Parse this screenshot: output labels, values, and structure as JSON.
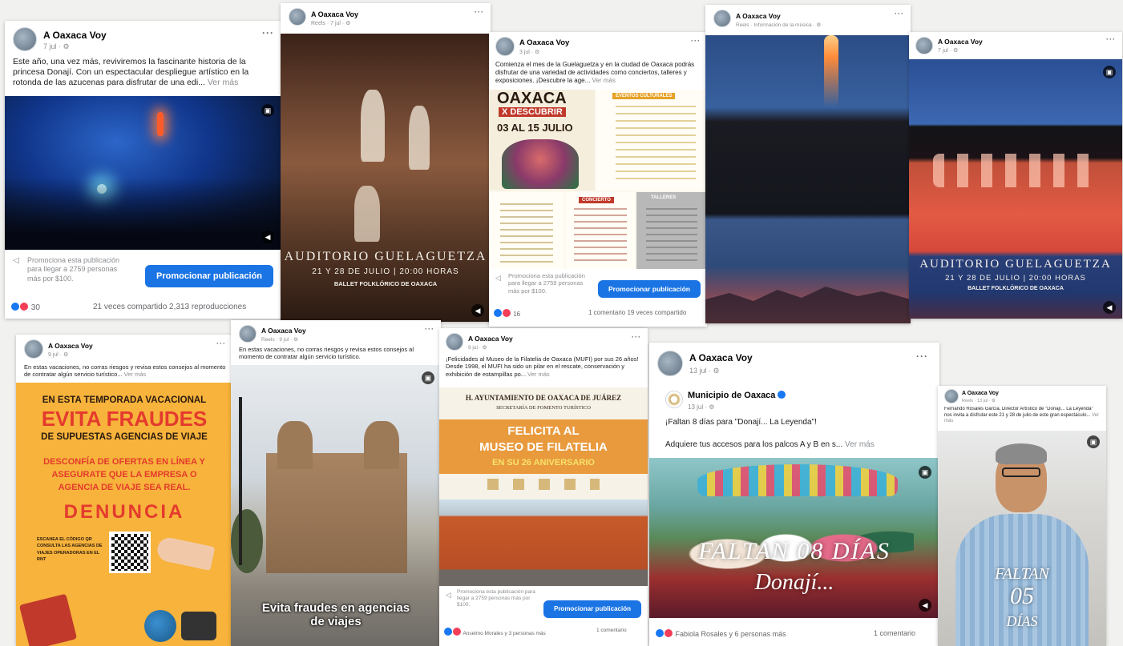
{
  "colors": {
    "facebook_blue": "#1b74e4",
    "fraud_red": "#e43a2e",
    "fraud_orange": "#f7b33b",
    "museum_orange": "#e89a3d"
  },
  "posts": [
    {
      "page": "A Oaxaca Voy",
      "meta": "7 jul · ⚙",
      "caption": "Este año, una vez más, reviviremos la fascinante historia de la princesa Donají. Con un espectacular despliegue artístico en la rotonda de las azucenas para disfrutar de una edi...",
      "see_more": "Ver más",
      "promo_text": "Promociona esta publicación para llegar a 2759 personas más por $100.",
      "promo_button": "Promocionar publicación",
      "reactions": "30",
      "stats": "21 veces compartido  2,313 reproducciones"
    },
    {
      "page": "A Oaxaca Voy",
      "meta": "Reels · 7 jul · ⚙",
      "title": "AUDITORIO GUELAGUETZA",
      "dates": "21 Y 28 DE JULIO | 20:00 HORAS",
      "subtitle": "BALLET FOLKLÓRICO DE OAXACA"
    },
    {
      "page": "A Oaxaca Voy",
      "meta": "3 jul · ⚙",
      "caption": "Comienza el mes de la Guelaguetza y en la ciudad de Oaxaca podrás disfrutar de una variedad de actividades como conciertos, talleres y exposiciones. ¡Descubre la age...",
      "see_more": "Ver más",
      "poster_title": "OAXACA",
      "poster_sub": "X DESCUBRIR",
      "poster_dates": "03 AL 15 JULIO",
      "poster_section1": "EVENTOS CULTURALES",
      "poster_section2": "CONCIERTO",
      "poster_section3": "TALLERES",
      "promo_text": "Promociona esta publicación para llegar a 2759 personas más por $100.",
      "promo_button": "Promocionar publicación",
      "reactions": "16",
      "stats": "1 comentario  19 veces compartido"
    },
    {
      "page": "A Oaxaca Voy",
      "meta": "Reels · Información de la música · ⚙"
    },
    {
      "page": "A Oaxaca Voy",
      "meta": "7 jul · ⚙",
      "title": "AUDITORIO GUELAGUETZA",
      "dates": "21 Y 28 DE JULIO | 20:00 HORAS",
      "subtitle": "BALLET FOLKLÓRICO DE OAXACA"
    },
    {
      "page": "A Oaxaca Voy",
      "meta": "9 jul · ⚙",
      "caption": "En estas vacaciones, no corras riesgos y revisa estos consejos al momento de contratar algún servicio turístico...",
      "see_more": "Ver más",
      "line1": "EN ESTA TEMPORADA VACACIONAL",
      "line2": "EVITA FRAUDES",
      "line3": "DE SUPUESTAS AGENCIAS DE VIAJE",
      "line4": "DESCONFÍA DE OFERTAS EN LÍNEA Y ASEGURATE QUE LA EMPRESA O AGENCIA DE VIAJE SEA REAL.",
      "line5": "DENUNCIA",
      "qr_text": "ESCANEA EL CÓDIGO QR CONSULTA LAS AGENCIAS DE VIAJES OPERADORAS EN EL RNT"
    },
    {
      "page": "A Oaxaca Voy",
      "meta": "Reels · 9 jul · ⚙",
      "caption": "En estas vacaciones, no corras riesgos y revisa estos consejos al momento de contratar algún servicio turístico.",
      "video_caption": "Evita fraudes en agencias de viajes"
    },
    {
      "page": "A Oaxaca Voy",
      "meta": "9 jul · ⚙",
      "caption": "¡Felicidades al Museo de la Filatelia de Oaxaca (MUFI) por sus 26 años! Desde 1998, el MUFI ha sido un pilar en el rescate, conservación y exhibición de estampillas po...",
      "see_more": "Ver más",
      "header1": "H. AYUNTAMIENTO DE OAXACA DE JUÁREZ",
      "header2": "SECRETARÍA DE FOMENTO TURÍSTICO",
      "banner1": "FELICITA AL",
      "banner2": "MUSEO DE FILATELIA",
      "banner3": "EN SU 26 ANIVERSARIO",
      "promo_text": "Promociona esta publicación para llegar a 2759 personas más por $100.",
      "promo_button": "Promocionar publicación",
      "reactions": "Anselmo Morales y 3 personas más",
      "stats": "1 comentario"
    },
    {
      "page": "A Oaxaca Voy",
      "meta": "13 jul · ⚙",
      "shared_page": "Municipio de Oaxaca",
      "shared_meta": "13 jul · ⚙",
      "caption1": "¡Faltan 8 días para \"Donají... La Leyenda\"!",
      "caption2": "Adquiere tus accesos para los palcos A y B en s...",
      "see_more": "Ver más",
      "overlay1": "FALTAN 08 DÍAS",
      "overlay2": "Donají...",
      "reactions": "Fabiola Rosales y 6 personas más",
      "stats": "1 comentario"
    },
    {
      "page": "A Oaxaca Voy",
      "meta": "Reels · 13 jul · ⚙",
      "caption": "Fernando Rosales García, Director Artístico de \"Donají... La Leyenda\" nos invita a disfrutar este 21 y 28 de julio de este gran espectáculo...",
      "see_more": "Ver más",
      "overlay1": "FALTAN",
      "overlay2": "05",
      "overlay3": "DÍAS"
    }
  ]
}
